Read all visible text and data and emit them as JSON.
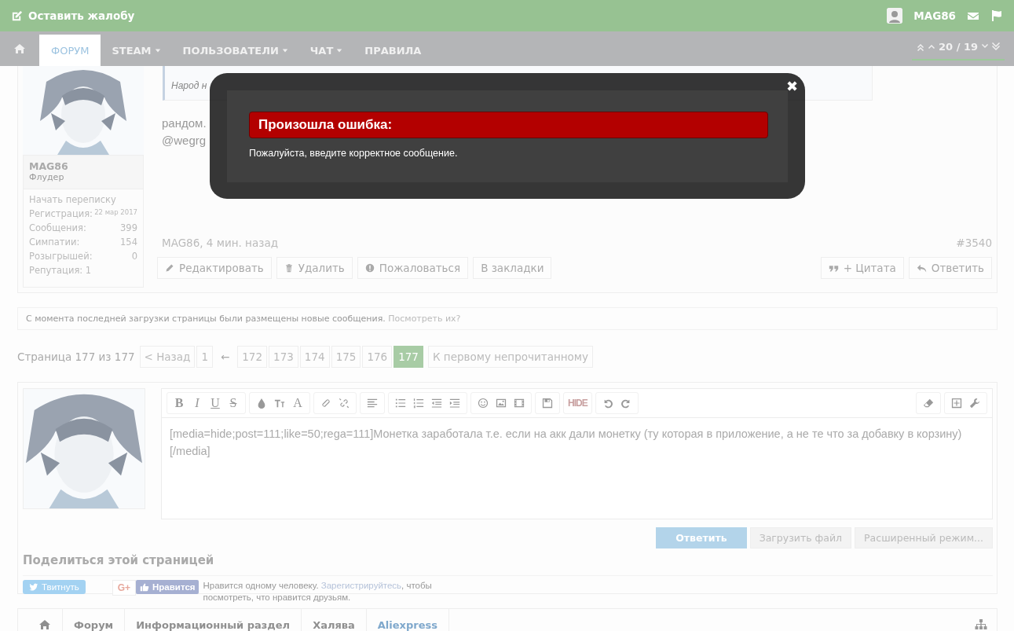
{
  "top_bar": {
    "complaint": "Оставить жалобу",
    "username": "MAG86"
  },
  "nav": {
    "tabs": [
      {
        "label": "ФОРУМ",
        "selected": true,
        "dropdown": false
      },
      {
        "label": "STEAM",
        "selected": false,
        "dropdown": true
      },
      {
        "label": "ПОЛЬЗОВАТЕЛИ",
        "selected": false,
        "dropdown": true
      },
      {
        "label": "ЧАТ",
        "selected": false,
        "dropdown": true
      },
      {
        "label": "ПРАВИЛА",
        "selected": false,
        "dropdown": false
      }
    ],
    "pager": "20 / 19"
  },
  "post": {
    "user": {
      "name": "MAG86",
      "title": "Флудер",
      "message_link": "Начать переписку",
      "stats": [
        {
          "label": "Регистрация:",
          "value": "22 мар 2017"
        },
        {
          "label": "Сообщения:",
          "value": "399"
        },
        {
          "label": "Симпатии:",
          "value": "154"
        },
        {
          "label": "Розыгрышей:",
          "value": "0"
        }
      ],
      "reputation": "Репутация: 1"
    },
    "quote": "Народ н",
    "lines": [
      "рандом.",
      "@wegrg"
    ],
    "meta": "MAG86, 4 мин. назад",
    "number": "#3540",
    "actions_left": [
      "Редактировать",
      "Удалить",
      "Пожаловаться",
      "В закладки"
    ],
    "actions_right": [
      "+ Цитата",
      "Ответить"
    ]
  },
  "notice": {
    "text": "С момента последней загрузки страницы были размещены новые сообщения.",
    "link": "Посмотреть их?"
  },
  "pagination": {
    "label": "Страница 177 из 177",
    "prev": "< Назад",
    "first": "1",
    "gap": "←",
    "pages": [
      {
        "label": "172",
        "selected": false
      },
      {
        "label": "173",
        "selected": false
      },
      {
        "label": "174",
        "selected": false
      },
      {
        "label": "175",
        "selected": false
      },
      {
        "label": "176",
        "selected": false
      },
      {
        "label": "177",
        "selected": true
      }
    ],
    "unread": "К первому непрочитанному"
  },
  "editor": {
    "text_buttons": [
      "B",
      "I",
      "U",
      "S",
      "A",
      "HIDE"
    ],
    "content": "[media=hide;post=111;like=50;rega=111]Монетка заработала т.е. если на акк дали монетку (ту которая в приложение, а не те что за добавку в корзину)[/media]",
    "buttons": [
      {
        "label": "Ответить",
        "kind": "primary"
      },
      {
        "label": "Загрузить файл",
        "kind": "secondary"
      },
      {
        "label": "Расширенный режим...",
        "kind": "secondary"
      }
    ]
  },
  "share": {
    "title": "Поделиться этой страницей",
    "tweet": "Твитнуть",
    "gplus": "G+",
    "like": "Нравится",
    "like_text_before": "Нравится одному человеку. ",
    "like_link": "Зарегистрируйтесь",
    "like_text_after": ", чтобы посмотреть, что нравится друзьям."
  },
  "breadcrumb": [
    {
      "label": "Форум",
      "current": false
    },
    {
      "label": "Информационный раздел",
      "current": false
    },
    {
      "label": "Халява",
      "current": false
    },
    {
      "label": "Aliexpress",
      "current": true
    }
  ],
  "modal": {
    "title": "Произошла ошибка:",
    "message": "Пожалуйста, введите корректное сообщение.",
    "close": "✖"
  }
}
